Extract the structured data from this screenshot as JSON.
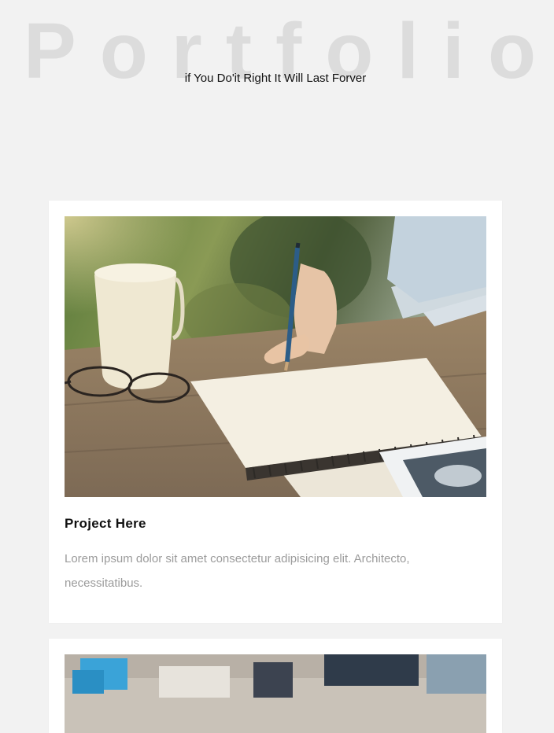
{
  "hero": {
    "title": "Portfolio",
    "subtitle": "if You Do'it Right It Will Last Forver"
  },
  "projects": [
    {
      "title": "Project Here",
      "description": "Lorem ipsum dolor sit amet consectetur adipisicing elit. Architecto, necessitatibus.",
      "image": "writing-notebook-coffee-photo"
    },
    {
      "title": "",
      "description": "",
      "image": "desk-workspace-photo"
    }
  ],
  "colors": {
    "page_background": "#f2f2f2",
    "card_background": "#ffffff",
    "hero_title": "#dcdcdc",
    "description_text": "#9b9b9b"
  }
}
